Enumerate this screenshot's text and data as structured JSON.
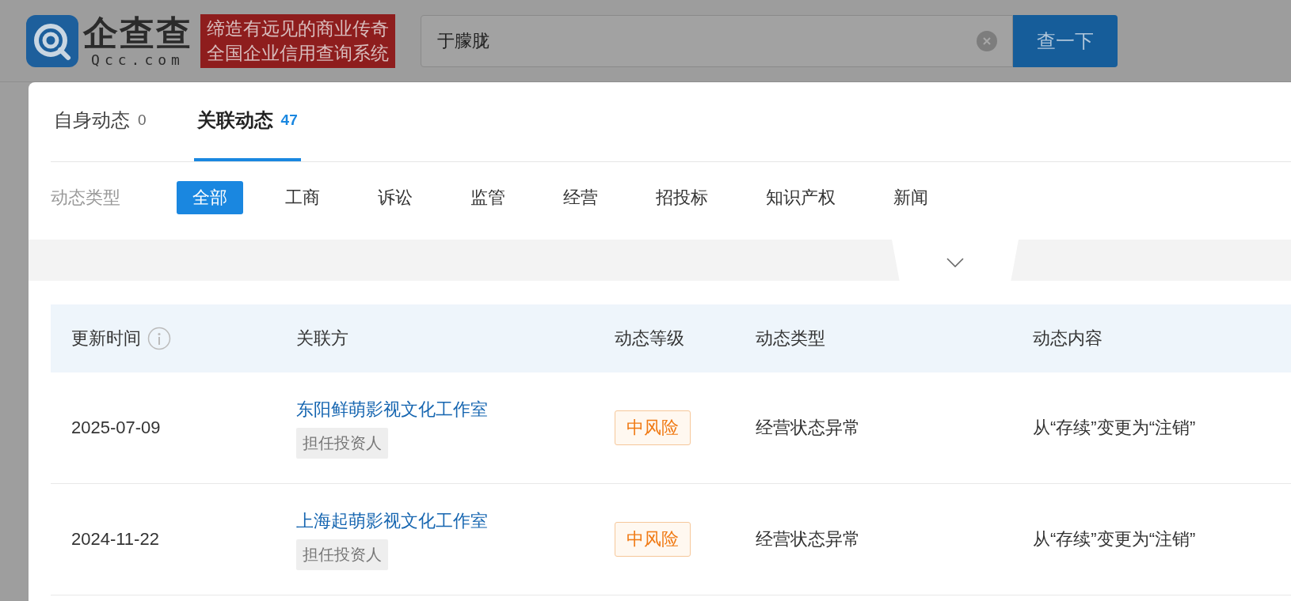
{
  "header": {
    "logo": {
      "name": "企查查",
      "domain": "Qcc.com"
    },
    "slogan": [
      "缔造有远见的商业传奇",
      "全国企业信用查询系统"
    ],
    "search": {
      "value": "于朦胧"
    },
    "search_button": "查一下"
  },
  "tabs": [
    {
      "label": "自身动态",
      "count": "0",
      "selected": false
    },
    {
      "label": "关联动态",
      "count": "47",
      "selected": true
    }
  ],
  "filter": {
    "label": "动态类型",
    "options": [
      {
        "label": "全部",
        "selected": true
      },
      {
        "label": "工商",
        "selected": false
      },
      {
        "label": "诉讼",
        "selected": false
      },
      {
        "label": "监管",
        "selected": false
      },
      {
        "label": "经营",
        "selected": false
      },
      {
        "label": "招投标",
        "selected": false
      },
      {
        "label": "知识产权",
        "selected": false
      },
      {
        "label": "新闻",
        "selected": false
      }
    ]
  },
  "table": {
    "columns": [
      {
        "label": "更新时间",
        "kind": "info"
      },
      {
        "label": "关联方",
        "kind": "plain"
      },
      {
        "label": "动态等级",
        "kind": "plain"
      },
      {
        "label": "动态类型",
        "kind": "plain"
      },
      {
        "label": "动态内容",
        "kind": "plain"
      }
    ],
    "rows": [
      {
        "date": "2025-07-09",
        "party": "东阳鲜萌影视文化工作室",
        "role": "担任投资人",
        "level": "中风险",
        "type": "经营状态异常",
        "content": "从“存续”变更为“注销”"
      },
      {
        "date": "2024-11-22",
        "party": "上海起萌影视文化工作室",
        "role": "担任投资人",
        "level": "中风险",
        "type": "经营状态异常",
        "content": "从“存续”变更为“注销”"
      }
    ]
  }
}
